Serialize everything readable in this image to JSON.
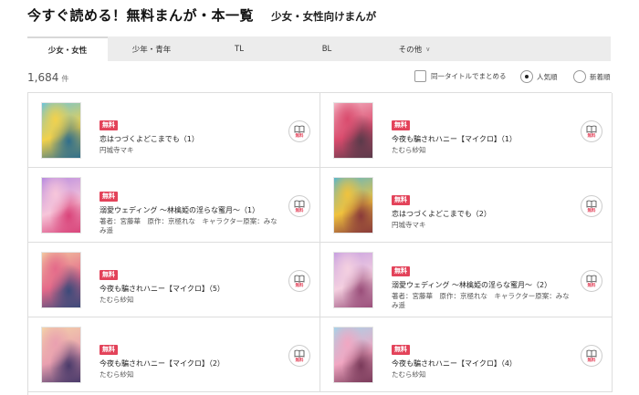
{
  "header": {
    "title": "今すぐ読める！無料まんが・本一覧",
    "subtitle": "少女・女性向けまんが"
  },
  "tabs": [
    {
      "label": "少女・女性",
      "active": true
    },
    {
      "label": "少年・青年",
      "active": false
    },
    {
      "label": "TL",
      "active": false
    },
    {
      "label": "BL",
      "active": false
    },
    {
      "label": "その他",
      "active": false
    }
  ],
  "results": {
    "count": "1,684",
    "unit": "件",
    "group_same_title_label": "同一タイトルでまとめる",
    "sort_popular_label": "人気順",
    "sort_new_label": "新着順",
    "selected_sort": "人気順"
  },
  "books": [
    {
      "badge": "無料",
      "title": "恋はつづくよどこまでも（1）",
      "author": "円城寺マキ",
      "read_label": "無料",
      "cover_colors": [
        "#6dc3d8",
        "#f2d14b",
        "#2f6e8c"
      ]
    },
    {
      "badge": "無料",
      "title": "今夜も騙されハニー【マイクロ】（1）",
      "author": "たむら紗知",
      "read_label": "無料",
      "cover_colors": [
        "#f4b3c2",
        "#d94b6d",
        "#5a3a4a"
      ]
    },
    {
      "badge": "無料",
      "title": "溺愛ウェディング ～林檎姫の淫らな蜜月～（1）",
      "author": "著者：宮藤華　原作：京極れな　キャラクター原案：みなみ遥",
      "read_label": "無料",
      "cover_colors": [
        "#b78adf",
        "#f7c6da",
        "#d9447a"
      ]
    },
    {
      "badge": "無料",
      "title": "恋はつづくよどこまでも（2）",
      "author": "円城寺マキ",
      "read_label": "無料",
      "cover_colors": [
        "#5cb6c9",
        "#f0c23d",
        "#8a3a3a"
      ]
    },
    {
      "badge": "無料",
      "title": "今夜も騙されハニー【マイクロ】（5）",
      "author": "たむら紗知",
      "read_label": "無料",
      "cover_colors": [
        "#f2c7a0",
        "#e46a8a",
        "#3b4a7a"
      ]
    },
    {
      "badge": "無料",
      "title": "溺愛ウェディング ～林檎姫の淫らな蜜月～（2）",
      "author": "著者：宮藤華　原作：京極れな　キャラクター原案：みなみ遥",
      "read_label": "無料",
      "cover_colors": [
        "#c7a0e0",
        "#f4d0e0",
        "#9a4e7a"
      ]
    },
    {
      "badge": "無料",
      "title": "今夜も騙されハニー【マイクロ】（2）",
      "author": "たむら紗知",
      "read_label": "無料",
      "cover_colors": [
        "#f3d3a8",
        "#e9a0b0",
        "#4a3a6a"
      ]
    },
    {
      "badge": "無料",
      "title": "今夜も騙されハニー【マイクロ】（4）",
      "author": "たむら紗知",
      "read_label": "無料",
      "cover_colors": [
        "#a6d2e8",
        "#f1a7c2",
        "#7a3a5a"
      ]
    }
  ],
  "colors": {
    "accent": "#e3435a",
    "tab_bar": "#ececec",
    "border": "#dddddd"
  },
  "icons": {
    "read_button": "book-icon",
    "tab_more": "chevron-down-icon"
  }
}
